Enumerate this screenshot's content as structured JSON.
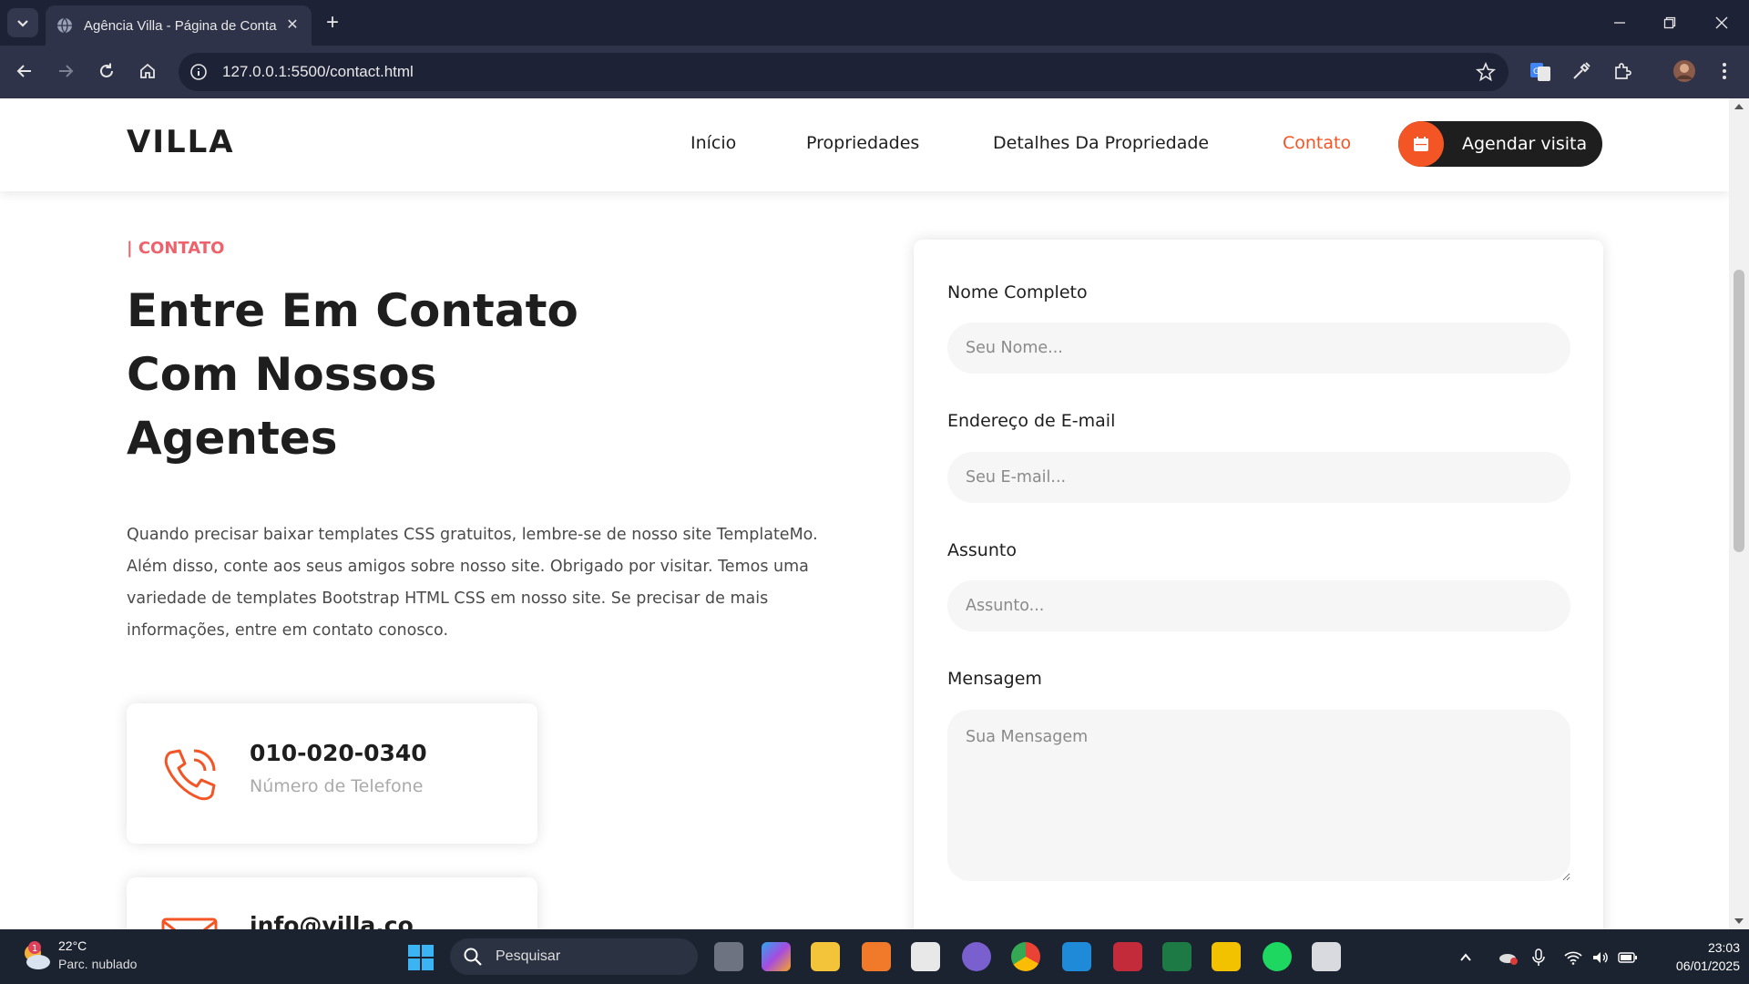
{
  "browser": {
    "tab_title": "Agência Villa - Página de Conta",
    "url": "127.0.0.1:5500/contact.html"
  },
  "site": {
    "logo": "VILLA",
    "nav": [
      {
        "label": "Início"
      },
      {
        "label": "Propriedades"
      },
      {
        "label": "Detalhes Da Propriedade"
      },
      {
        "label": "Contato",
        "active": true
      }
    ],
    "cta_label": "Agendar visita",
    "accent": "#f35525"
  },
  "contact": {
    "eyebrow": "| CONTATO",
    "headline_lines": [
      "Entre Em Contato",
      "Com Nossos",
      "Agentes"
    ],
    "paragraph": "Quando precisar baixar templates CSS gratuitos, lembre-se de nosso site TemplateMo. Além disso, conte aos seus amigos sobre nosso site. Obrigado por visitar. Temos uma variedade de templates Bootstrap HTML CSS em nosso site. Se precisar de mais informações, entre em contato conosco.",
    "cards": [
      {
        "value": "010-020-0340",
        "label": "Número de Telefone",
        "icon": "phone-icon"
      },
      {
        "value": "info@villa.co",
        "label": "",
        "icon": "mail-icon"
      }
    ]
  },
  "form": {
    "name_label": "Nome Completo",
    "name_placeholder": "Seu Nome...",
    "email_label": "Endereço de E-mail",
    "email_placeholder": "Seu E-mail...",
    "subject_label": "Assunto",
    "subject_placeholder": "Assunto...",
    "message_label": "Mensagem",
    "message_placeholder": "Sua Mensagem"
  },
  "taskbar": {
    "weather_temp": "22°C",
    "weather_desc": "Parc. nublado",
    "weather_badge": "1",
    "search_placeholder": "Pesquisar",
    "time": "23:03",
    "date": "06/01/2025"
  }
}
